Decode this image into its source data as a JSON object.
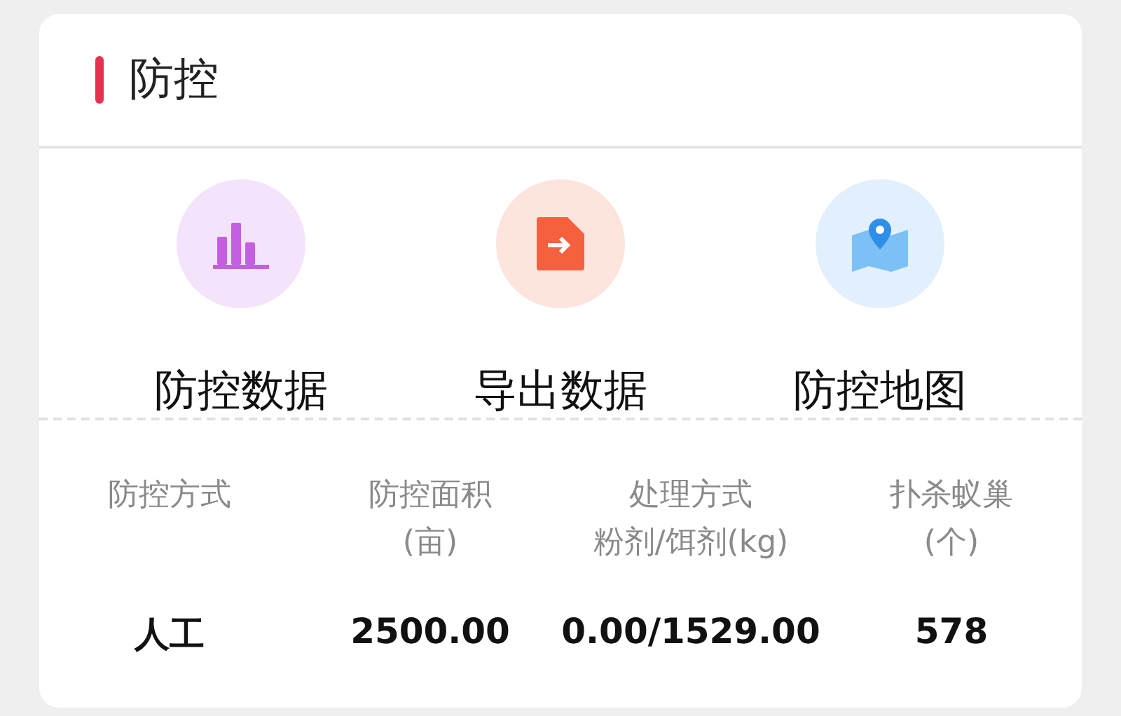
{
  "card": {
    "title": "防控"
  },
  "actions": [
    {
      "label": "防控数据",
      "kind": "chart"
    },
    {
      "label": "导出数据",
      "kind": "export"
    },
    {
      "label": "防控地图",
      "kind": "map"
    }
  ],
  "table": {
    "columns": [
      {
        "lines": [
          "防控方式"
        ]
      },
      {
        "lines": [
          "防控面积",
          "(亩)"
        ]
      },
      {
        "lines": [
          "处理方式",
          "粉剂/饵剂(kg)"
        ]
      },
      {
        "lines": [
          "扑杀蚁巢",
          "(个)"
        ]
      }
    ],
    "rows": [
      [
        "人工",
        "2500.00",
        "0.00/1529.00",
        "578"
      ]
    ]
  }
}
